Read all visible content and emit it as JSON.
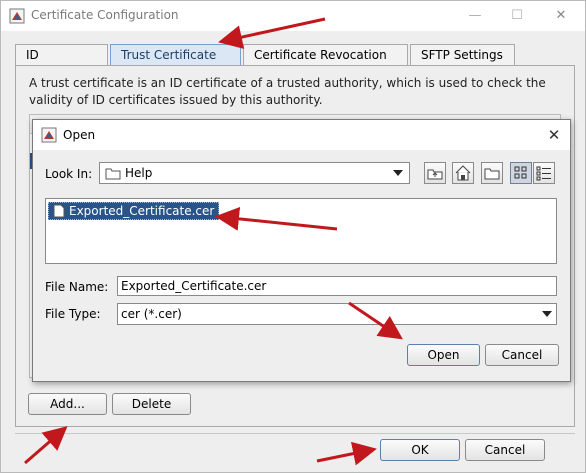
{
  "window": {
    "title": "Certificate Configuration",
    "minimize_glyph": "—",
    "maximize_glyph": "☐",
    "close_glyph": "✕"
  },
  "tabs": [
    {
      "label": "ID Certificate",
      "active": false
    },
    {
      "label": "Trust Certificate",
      "active": true
    },
    {
      "label": "Certificate Revocation List",
      "active": false
    },
    {
      "label": "SFTP Settings",
      "active": false
    }
  ],
  "trust_panel": {
    "description": "A trust certificate is an ID certificate of a trusted authority, which is used to check the validity of ID certificates issued by this authority.",
    "add_label": "Add...",
    "delete_label": "Delete"
  },
  "footer": {
    "ok_label": "OK",
    "cancel_label": "Cancel"
  },
  "open_dialog": {
    "title": "Open",
    "close_glyph": "✕",
    "look_in_label": "Look In:",
    "look_in_value": "Help",
    "toolbar_icons": [
      "up-one-level-icon",
      "home-icon",
      "new-folder-icon",
      "list-view-icon",
      "details-view-icon"
    ],
    "files": [
      "Exported_Certificate.cer"
    ],
    "file_name_label": "File Name:",
    "file_name_value": "Exported_Certificate.cer",
    "file_type_label": "File Type:",
    "file_type_value": "cer (*.cer)",
    "open_label": "Open",
    "cancel_label": "Cancel"
  },
  "colors": {
    "annotation_arrow": "#c0181c",
    "selection": "#28548a",
    "active_tab": "#dbe7f4"
  }
}
